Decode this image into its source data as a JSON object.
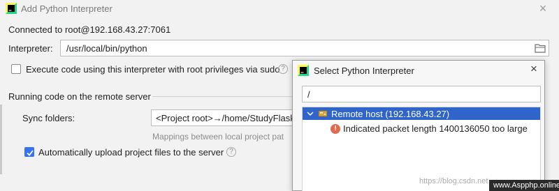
{
  "window": {
    "title": "Add Python Interpreter",
    "close_icon": "close-icon"
  },
  "connection": {
    "text": "Connected to root@192.168.43.27:7061"
  },
  "interpreter": {
    "label": "Interpreter:",
    "value": "/usr/local/bin/python",
    "browse_icon": "folder-icon"
  },
  "sudo_option": {
    "label": "Execute code using this interpreter with root privileges via sudo",
    "checked": false
  },
  "remote_section": {
    "title": "Running code on the remote server",
    "sync_label": "Sync folders:",
    "sync_value": "<Project root>→/home/StudyFlaskA",
    "mapping_hint": "Mappings between local project pat",
    "upload_label": "Automatically upload project files to the server",
    "upload_checked": true
  },
  "popup": {
    "title": "Select Python Interpreter",
    "path_value": "/",
    "tree": {
      "host_label": "Remote host (192.168.43.27)",
      "error_label": "Indicated packet length 1400136050 too large"
    }
  },
  "watermark": {
    "text": "https://blog.csdn.net",
    "badge": "www.Aspphp.online"
  },
  "colors": {
    "selection": "#2f65ca",
    "checkbox_checked": "#3574f0",
    "error": "#e06c4f"
  }
}
